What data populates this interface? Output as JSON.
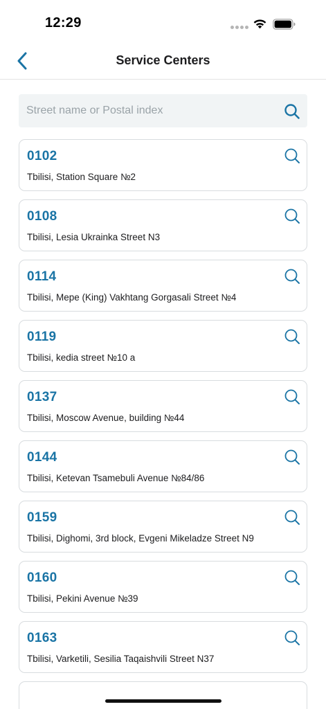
{
  "status_bar": {
    "time": "12:29"
  },
  "header": {
    "title": "Service Centers",
    "back_icon": "chevron-left-icon",
    "accent_color": "#1a74a5"
  },
  "search": {
    "placeholder": "Street name or Postal index",
    "value": "",
    "icon": "search-icon"
  },
  "centers": [
    {
      "code": "0102",
      "address": "Tbilisi, Station Square №2"
    },
    {
      "code": "0108",
      "address": "Tbilisi, Lesia Ukrainka Street N3"
    },
    {
      "code": "0114",
      "address": "Tbilisi, Mepe (King) Vakhtang Gorgasali Street №4"
    },
    {
      "code": "0119",
      "address": "Tbilisi, kedia street №10 a"
    },
    {
      "code": "0137",
      "address": "Tbilisi, Moscow Avenue, building №44"
    },
    {
      "code": "0144",
      "address": "Tbilisi, Ketevan Tsamebuli Avenue №84/86"
    },
    {
      "code": "0159",
      "address": "Tbilisi, Dighomi, 3rd block, Evgeni Mikeladze Street N9"
    },
    {
      "code": "0160",
      "address": "Tbilisi, Pekini Avenue №39"
    },
    {
      "code": "0163",
      "address": "Tbilisi, Varketili, Sesilia Taqaishvili Street N37"
    }
  ]
}
